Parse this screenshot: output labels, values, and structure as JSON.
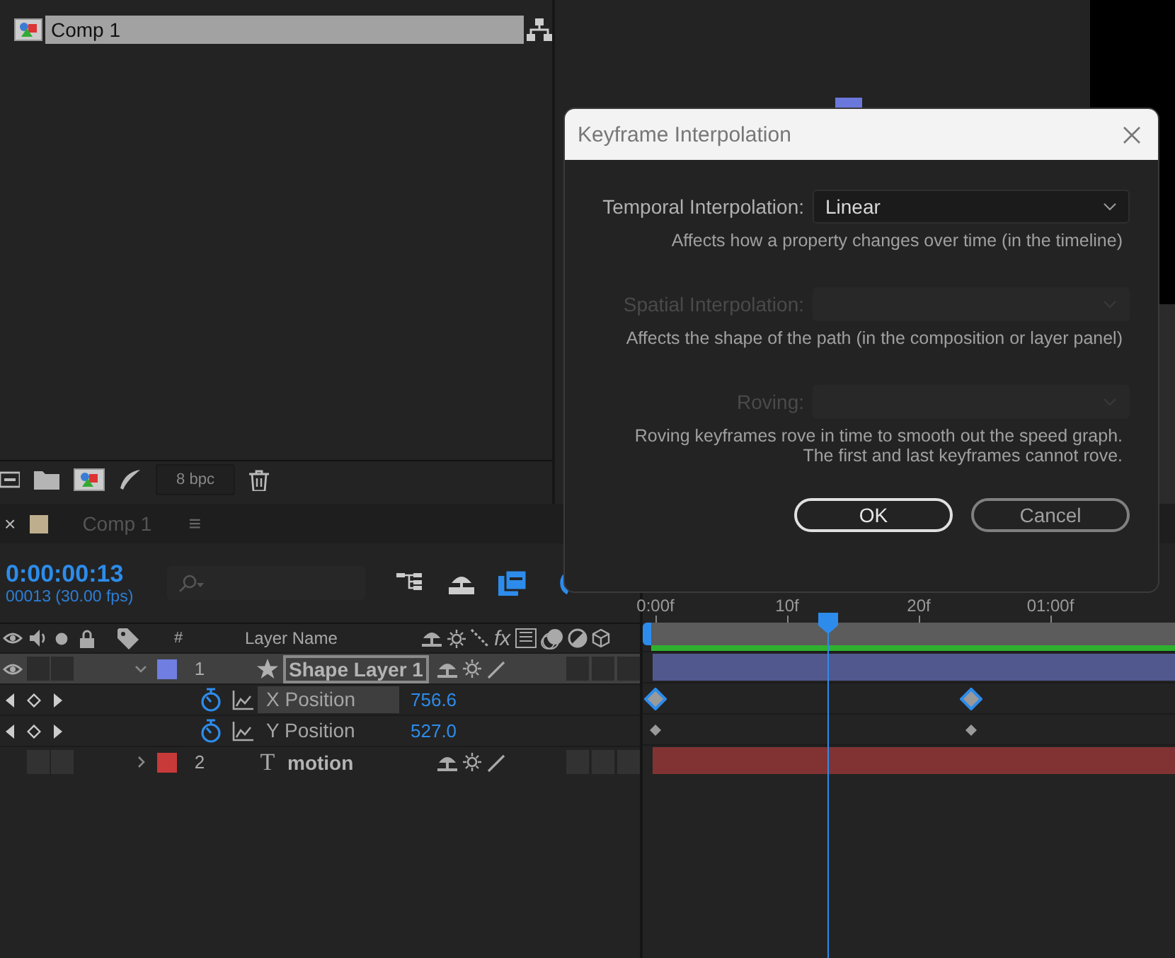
{
  "project_panel": {
    "items": [
      {
        "name": "Comp 1",
        "selected": true
      }
    ],
    "bit_depth": "8 bpc"
  },
  "timeline": {
    "tab": {
      "close": "×",
      "title": "Comp 1",
      "menu": "≡"
    },
    "current_time": "0:00:00:13",
    "frame_info": "00013 (30.00 fps)",
    "ruler": [
      "0:00f",
      "10f",
      "20f",
      "01:00f"
    ],
    "columns": {
      "number": "#",
      "layer_name": "Layer Name",
      "effects": "fx"
    },
    "layers": [
      {
        "number": "1",
        "name": "Shape Layer 1",
        "kind": "shape",
        "color": "#6f7ee0",
        "expanded": true,
        "selected": true,
        "properties": [
          {
            "name": "X Position",
            "value": "756.6",
            "selected": true
          },
          {
            "name": "Y Position",
            "value": "527.0",
            "selected": false
          }
        ]
      },
      {
        "number": "2",
        "name": "motion",
        "kind": "text",
        "icon": "T",
        "color": "#c83a3a",
        "expanded": false,
        "selected": false
      }
    ]
  },
  "dialog": {
    "title": "Keyframe Interpolation",
    "fields": [
      {
        "label": "Temporal Interpolation:",
        "value": "Linear",
        "disabled": false,
        "hints": [
          "Affects how a property changes over time (in the timeline)"
        ]
      },
      {
        "label": "Spatial Interpolation:",
        "disabled": true,
        "hints": [
          "Affects the shape of the path (in the composition or layer panel)"
        ]
      },
      {
        "label": "Roving:",
        "disabled": true,
        "hints": [
          "Roving keyframes rove in time to smooth out the speed graph.",
          "The first and last keyframes cannot rove."
        ]
      }
    ],
    "buttons": [
      {
        "label": "OK",
        "default": true
      },
      {
        "label": "Cancel",
        "default": false
      }
    ]
  }
}
